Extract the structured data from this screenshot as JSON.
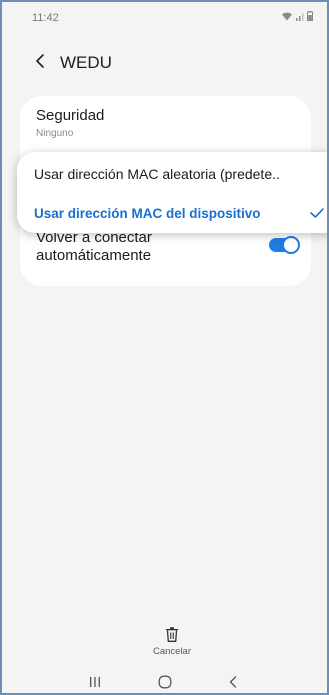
{
  "status_bar": {
    "time": "11:42"
  },
  "header": {
    "title": "WEDU",
    "back_icon": "chevron-left-icon"
  },
  "security": {
    "title": "Seguridad",
    "value": "Ninguno"
  },
  "mac_popup": {
    "options": [
      {
        "label": "Usar dirección MAC aleatoria (predete..",
        "selected": false
      },
      {
        "label": "Usar dirección MAC del dispositivo",
        "selected": true
      }
    ]
  },
  "reconnect": {
    "label_line1": "Volver a conectar",
    "label_line2": "automáticamente",
    "enabled": true
  },
  "footer": {
    "cancel_label": "Cancelar",
    "cancel_icon": "trash-icon"
  },
  "navbar": {
    "recents_icon": "recents-icon",
    "home_icon": "home-icon",
    "back_icon": "back-nav-icon"
  },
  "colors": {
    "accent": "#1f7de6",
    "selected_text": "#1a6fd0",
    "background": "#f4f4f4",
    "frame_border": "#6d8fb3"
  }
}
